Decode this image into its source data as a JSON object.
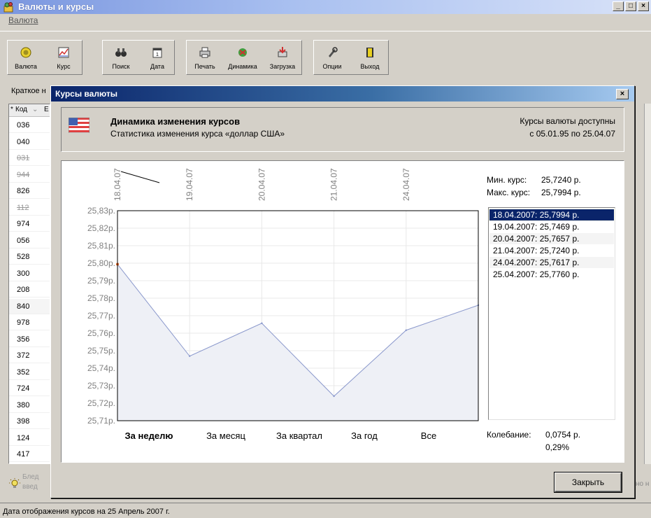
{
  "app": {
    "title": "Валюты и курсы",
    "menu_valuta": "Валюта",
    "window_buttons": [
      "_",
      "□",
      "×"
    ]
  },
  "toolbar": {
    "groups": [
      [
        {
          "label": "Валюта",
          "icon": "currency-icon"
        },
        {
          "label": "Курс",
          "icon": "rate-chart-icon"
        }
      ],
      [
        {
          "label": "Поиск",
          "icon": "binoculars-icon"
        },
        {
          "label": "Дата",
          "icon": "calendar-icon"
        }
      ],
      [
        {
          "label": "Печать",
          "icon": "printer-icon"
        },
        {
          "label": "Динамика",
          "icon": "dynamics-icon"
        },
        {
          "label": "Загрузка",
          "icon": "download-icon"
        }
      ],
      [
        {
          "label": "Опции",
          "icon": "options-icon"
        },
        {
          "label": "Выход",
          "icon": "exit-door-icon"
        }
      ]
    ]
  },
  "left_panel": {
    "label": "Краткое н",
    "header_code": "Код",
    "header_extra": "Е",
    "codes": [
      "036",
      "040",
      "031",
      "944",
      "826",
      "112",
      "974",
      "056",
      "528",
      "300",
      "208",
      "840",
      "978",
      "356",
      "372",
      "352",
      "724",
      "380",
      "398",
      "124",
      "417"
    ],
    "struck": [
      "031",
      "944",
      "112"
    ],
    "selected": "840"
  },
  "hint": {
    "text_line1": "Блед",
    "text_line2": "введ"
  },
  "right_strip_text": "но н",
  "status": {
    "text": "Дата отображения курсов на 25 Апрель 2007 г."
  },
  "dialog": {
    "title": "Курсы валюты",
    "close_glyph": "×",
    "info": {
      "title": "Динамика изменения курсов",
      "subtitle": "Статистика изменения курса «доллар США»",
      "avail_title": "Курсы валюты доступны",
      "avail_range": "с 05.01.95 по 25.04.07"
    },
    "min_label": "Мин. курс:",
    "min_value": "25,7240 р.",
    "max_label": "Макс. курс:",
    "max_value": "25,7994 р.",
    "rates": [
      {
        "text": "18.04.2007: 25,7994 р."
      },
      {
        "text": "19.04.2007: 25,7469 р."
      },
      {
        "text": "20.04.2007: 25,7657 р."
      },
      {
        "text": "21.04.2007: 25,7240 р."
      },
      {
        "text": "24.04.2007: 25,7617 р."
      },
      {
        "text": "25.04.2007: 25,7760 р."
      }
    ],
    "selected_rate_index": 0,
    "ranges": [
      "За неделю",
      "За месяц",
      "За квартал",
      "За год",
      "Все"
    ],
    "active_range": "За неделю",
    "fluct_label": "Колебание:",
    "fluct_value": "0,0754 р.",
    "fluct_pct": "0,29%",
    "close_label": "Закрыть"
  },
  "chart_data": {
    "type": "area",
    "title": "",
    "x_labels": [
      "18.04.07",
      "19.04.07",
      "20.04.07",
      "21.04.07",
      "24.04.07"
    ],
    "x": [
      "18.04.2007",
      "19.04.2007",
      "20.04.2007",
      "21.04.2007",
      "24.04.2007",
      "25.04.2007"
    ],
    "values": [
      25.7994,
      25.7469,
      25.7657,
      25.724,
      25.7617,
      25.776
    ],
    "y_ticks": [
      "25,83р.",
      "25,82р.",
      "25,81р.",
      "25,80р.",
      "25,79р.",
      "25,78р.",
      "25,77р.",
      "25,76р.",
      "25,75р.",
      "25,74р.",
      "25,73р.",
      "25,72р.",
      "25,71р."
    ],
    "ylim": [
      25.71,
      25.83
    ],
    "grid": true,
    "line_color": "#8a98cc",
    "fill_color": "#eef0f6",
    "marker_color": "#e06020"
  }
}
